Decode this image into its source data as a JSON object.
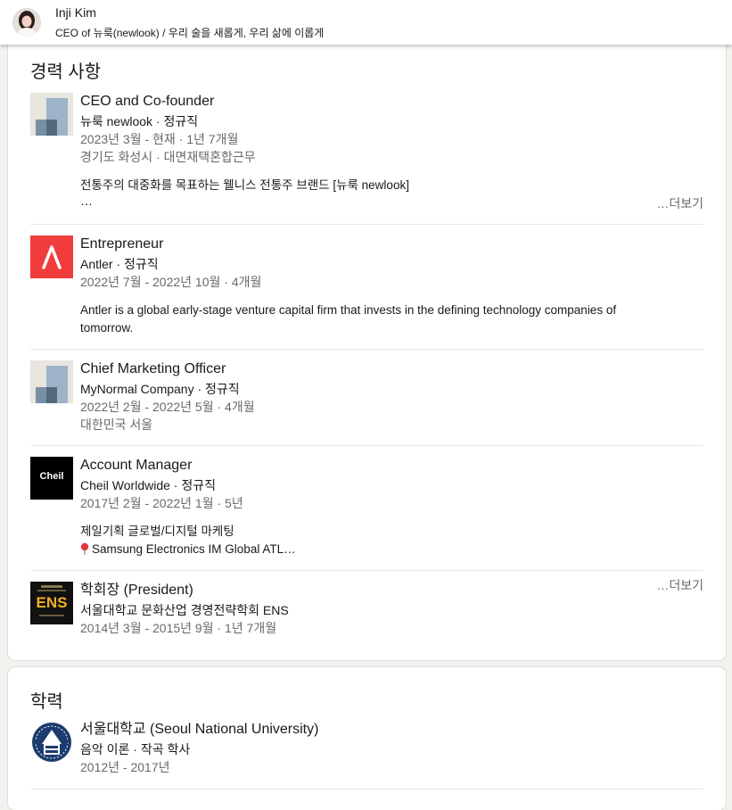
{
  "header": {
    "name": "Inji Kim",
    "headline": "CEO of 뉴룩(newlook) / 우리 술을 새롭게, 우리 삶에 이롭게"
  },
  "experience": {
    "title": "경력 사항",
    "see_more_label": "…더보기",
    "items": [
      {
        "role": "CEO and Co-founder",
        "company": "뉴룩 newlook · 정규직",
        "dates": "2023년 3월 - 현재 · 1년 7개월",
        "location": "경기도 화성시 · 대면재택혼합근무",
        "description": "전통주의 대중화를 목표하는 웰니스 전통주 브랜드 [뉴룩 newlook]",
        "description_cont": "…",
        "logo": "default-company-logo"
      },
      {
        "role": "Entrepreneur",
        "company": "Antler · 정규직",
        "dates": "2022년 7월 - 2022년 10월 · 4개월",
        "description": "Antler is a global early-stage venture capital firm that invests in the defining technology companies of",
        "description_cont": "tomorrow.",
        "logo": "antler-logo",
        "logo_color": "#f03c3c"
      },
      {
        "role": "Chief Marketing Officer",
        "company": "MyNormal Company · 정규직",
        "dates": "2022년 2월 - 2022년 5월 · 4개월",
        "location": "대한민국 서울",
        "logo": "default-company-logo"
      },
      {
        "role": "Account Manager",
        "company": "Cheil Worldwide · 정규직",
        "dates": "2017년 2월 - 2022년 1월 · 5년",
        "description": "제일기획 글로벌/디지털 마케팅",
        "description_cont": "Samsung Electronics IM Global ATL…",
        "logo": "cheil-logo",
        "logo_text": "Cheil",
        "pin_icon": "round-pushpin-icon"
      },
      {
        "role": "학회장 (President)",
        "company": "서울대학교 문화산업 경영전략학회 ENS",
        "dates": "2014년 3월 - 2015년 9월 · 1년 7개월",
        "logo": "ens-logo",
        "logo_text": "ENS",
        "logo_color": "#f2b01e"
      }
    ]
  },
  "education": {
    "title": "학력",
    "items": [
      {
        "school": "서울대학교 (Seoul National University)",
        "degree": "음악 이론 · 작곡 학사",
        "dates": "2012년 - 2017년",
        "logo": "snu-emblem-logo"
      }
    ]
  },
  "colors": {
    "page_bg": "#f4f2ee",
    "card_bg": "#ffffff",
    "secondary_text": "rgba(0,0,0,0.6)",
    "divider": "#e8e8e8"
  }
}
